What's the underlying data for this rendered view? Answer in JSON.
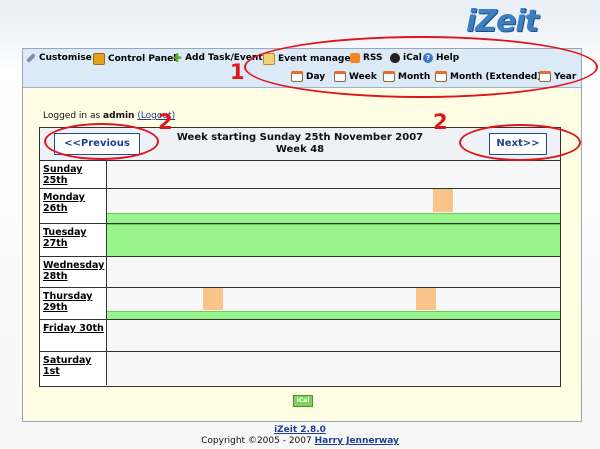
{
  "app": {
    "logo": "iZeit"
  },
  "menu": {
    "row1": [
      {
        "label": "Customise",
        "icon": "wrench-icon"
      },
      {
        "label": "Control Panel",
        "icon": "control-panel-icon"
      },
      {
        "label": "Add Task/Event",
        "icon": "plus-icon"
      },
      {
        "label": "Event manager",
        "icon": "event-manager-icon"
      },
      {
        "label": "RSS",
        "icon": "rss-icon"
      },
      {
        "label": "iCal",
        "icon": "apple-icon"
      },
      {
        "label": "Help",
        "icon": "help-icon"
      }
    ],
    "row2": [
      {
        "label": "Day",
        "icon": "calendar-icon"
      },
      {
        "label": "Week",
        "icon": "calendar-icon"
      },
      {
        "label": "Month",
        "icon": "calendar-icon"
      },
      {
        "label": "Month (Extended)",
        "icon": "calendar-icon"
      },
      {
        "label": "Year",
        "icon": "calendar-icon"
      }
    ]
  },
  "session": {
    "prefix": "Logged in as",
    "user": "admin",
    "logout": "(Logout)"
  },
  "calendar": {
    "title_line1": "Week starting Sunday 25th November 2007",
    "title_line2": "Week 48",
    "prev_label": "<<Previous",
    "next_label": "Next>>",
    "days": [
      {
        "label": "Sunday 25th"
      },
      {
        "label": "Monday 26th"
      },
      {
        "label": "Tuesday 27th"
      },
      {
        "label": "Wednesday 28th"
      },
      {
        "label": "Thursday 29th"
      },
      {
        "label": "Friday 30th"
      },
      {
        "label": "Saturday 1st"
      }
    ]
  },
  "ical_button": "iCal",
  "footer": {
    "version": "iZeit 2.8.0",
    "copyright": "Copyright ©2005 - 2007",
    "author": "Harry Jennerway"
  },
  "annotations": {
    "label1": "1",
    "label2a": "2",
    "label2b": "2"
  },
  "colors": {
    "annotation": "#e0141b",
    "allday": "#98f58c",
    "event": "#f8c48a",
    "menubar": "#dce9f7",
    "page": "#fffde3"
  }
}
